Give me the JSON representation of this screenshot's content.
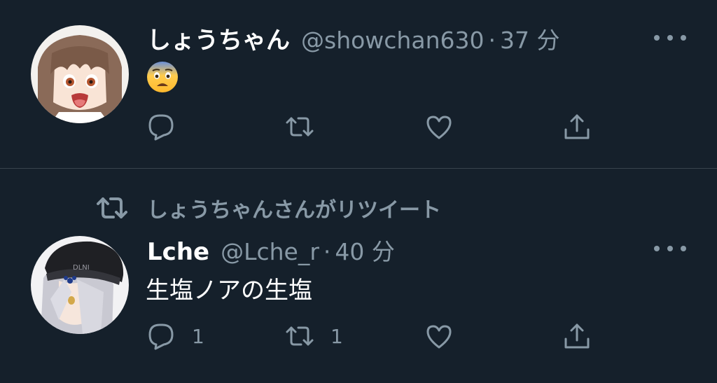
{
  "tweets": [
    {
      "display_name": "しょうちゃん",
      "handle": "@showchan630",
      "separator": "·",
      "time": "37 分",
      "body_emoji": "fearful-face-emoji",
      "avatar": "anime-girl-brown-hair-avatar",
      "actions": {
        "reply_count": "",
        "retweet_count": "",
        "like_count": ""
      }
    },
    {
      "retweet_context": "しょうちゃんさんがリツイート",
      "display_name": "Lche",
      "handle": "@Lche_r",
      "separator": "·",
      "time": "40 分",
      "text": "生塩ノアの生塩",
      "avatar": "anime-girl-silver-hair-beanie-avatar",
      "actions": {
        "reply_count": "1",
        "retweet_count": "1",
        "like_count": ""
      }
    }
  ],
  "icons": {
    "reply": "reply-icon",
    "retweet": "retweet-icon",
    "like": "heart-icon",
    "share": "share-icon",
    "more": "more-icon"
  },
  "colors": {
    "background": "#15202b",
    "secondary_text": "#8899a6",
    "divider": "#38444d"
  }
}
